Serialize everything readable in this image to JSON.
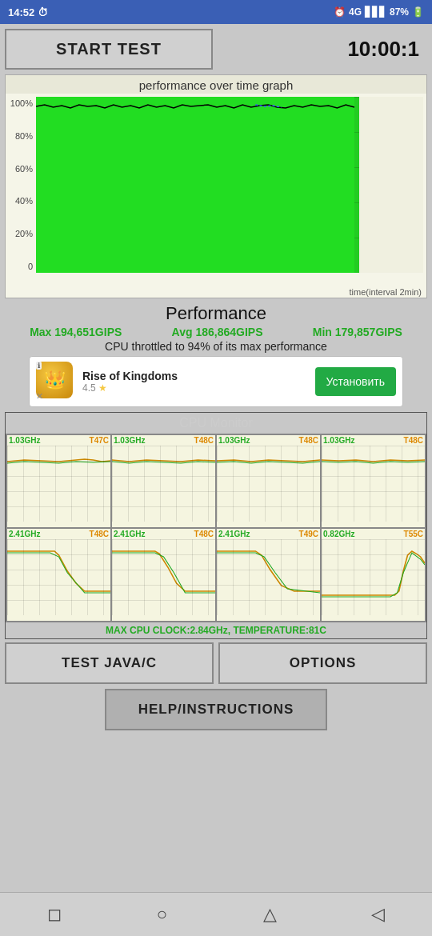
{
  "statusBar": {
    "time": "14:52",
    "clock_icon": "🕐",
    "alarm_icon": "⏰",
    "signal": "4G",
    "battery": "87%"
  },
  "header": {
    "start_test_label": "START TEST",
    "timer": "10:00:1"
  },
  "graph": {
    "title": "performance over time graph",
    "y_labels": [
      "100%",
      "80%",
      "60%",
      "40%",
      "20%",
      "0"
    ],
    "time_label": "time(interval 2min)"
  },
  "performance": {
    "title": "Performance",
    "max_label": "Max 194,651GIPS",
    "avg_label": "Avg 186,864GIPS",
    "min_label": "Min 179,857GIPS",
    "throttle_text": "CPU throttled to 94% of its max performance"
  },
  "ad": {
    "name": "Rise of Kingdoms",
    "rating": "4.5",
    "install_label": "Установить"
  },
  "cpu_monitor": {
    "title": "CPU Monitor",
    "cells": [
      {
        "freq": "1.03GHz",
        "temp": "T47C"
      },
      {
        "freq": "1.03GHz",
        "temp": "T48C"
      },
      {
        "freq": "1.03GHz",
        "temp": "T48C"
      },
      {
        "freq": "1.03GHz",
        "temp": "T48C"
      },
      {
        "freq": "2.41GHz",
        "temp": "T48C"
      },
      {
        "freq": "2.41GHz",
        "temp": "T48C"
      },
      {
        "freq": "2.41GHz",
        "temp": "T49C"
      },
      {
        "freq": "0.82GHz",
        "temp": "T55C"
      }
    ],
    "max_label": "MAX CPU CLOCK:2.84GHz, TEMPERATURE:81C"
  },
  "buttons": {
    "test_java": "TEST JAVA/C",
    "options": "OPTIONS",
    "help": "HELP/INSTRUCTIONS"
  },
  "nav": {
    "square": "◻",
    "circle": "○",
    "triangle": "△",
    "back": "◁"
  }
}
